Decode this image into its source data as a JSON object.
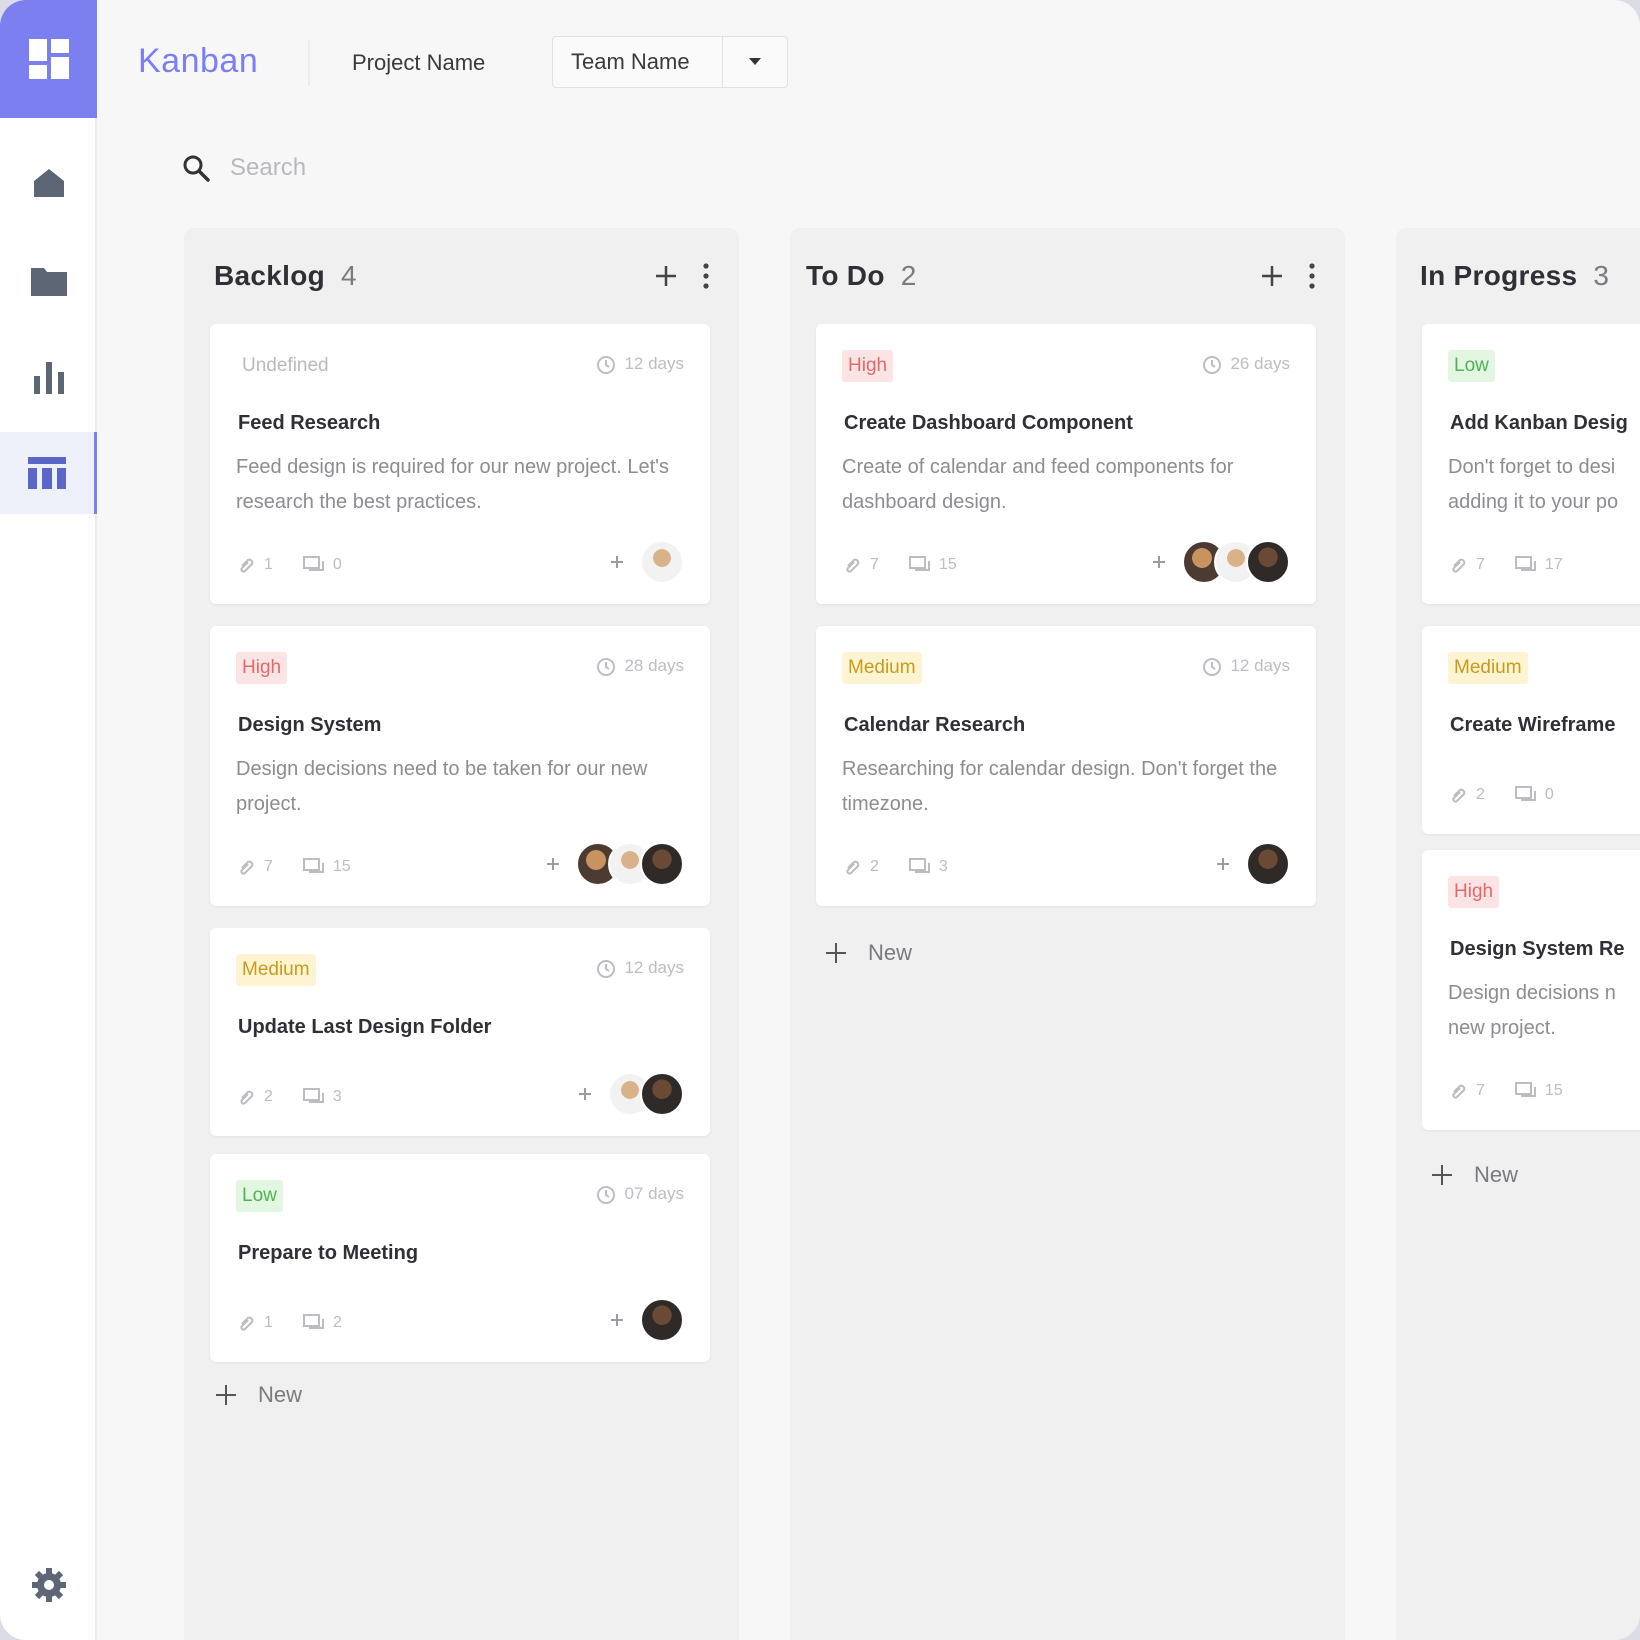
{
  "header": {
    "brand": "Kanban",
    "project_name": "Project Name",
    "team_select": "Team Name"
  },
  "search": {
    "placeholder": "Search"
  },
  "colors": {
    "accent": "#7b7ff0",
    "high": "#e06a6a",
    "medium": "#c79b1e",
    "low": "#4fb255"
  },
  "icons": {
    "sidebar": [
      "dashboard-icon",
      "home-icon",
      "folder-icon",
      "chart-icon",
      "board-icon",
      "settings-icon"
    ]
  },
  "columns": [
    {
      "title": "Backlog",
      "count": "4",
      "new_label": "New",
      "cards": [
        {
          "tag": "Undefined",
          "due": "12 days",
          "title": "Feed Research",
          "desc": "Feed design is required for our new project. Let's research the best practices.",
          "attachments": "1",
          "comments": "0"
        },
        {
          "tag": "High",
          "due": "28 days",
          "title": "Design System",
          "desc": "Design decisions need to be taken for our new project.",
          "attachments": "7",
          "comments": "15"
        },
        {
          "tag": "Medium",
          "due": "12 days",
          "title": "Update Last Design Folder",
          "desc": "",
          "attachments": "2",
          "comments": "3"
        },
        {
          "tag": "Low",
          "due": "07 days",
          "title": "Prepare to Meeting",
          "desc": "",
          "attachments": "1",
          "comments": "2"
        }
      ]
    },
    {
      "title": "To Do",
      "count": "2",
      "new_label": "New",
      "cards": [
        {
          "tag": "High",
          "due": "26 days",
          "title": "Create Dashboard Component",
          "desc": "Create of calendar and feed components for dashboard design.",
          "attachments": "7",
          "comments": "15"
        },
        {
          "tag": "Medium",
          "due": "12 days",
          "title": "Calendar Research",
          "desc": "Researching for calendar design. Don't forget the timezone.",
          "attachments": "2",
          "comments": "3"
        }
      ]
    },
    {
      "title": "In Progress",
      "count": "3",
      "new_label": "New",
      "cards": [
        {
          "tag": "Low",
          "title": "Add Kanban Desig",
          "desc": "Don't forget to desi adding it to your po",
          "attachments": "7",
          "comments": "17"
        },
        {
          "tag": "Medium",
          "title": "Create Wireframe",
          "desc": "",
          "attachments": "2",
          "comments": "0"
        },
        {
          "tag": "High",
          "title": "Design System Re",
          "desc": "Design decisions n new project.",
          "attachments": "7",
          "comments": "15"
        }
      ]
    }
  ]
}
